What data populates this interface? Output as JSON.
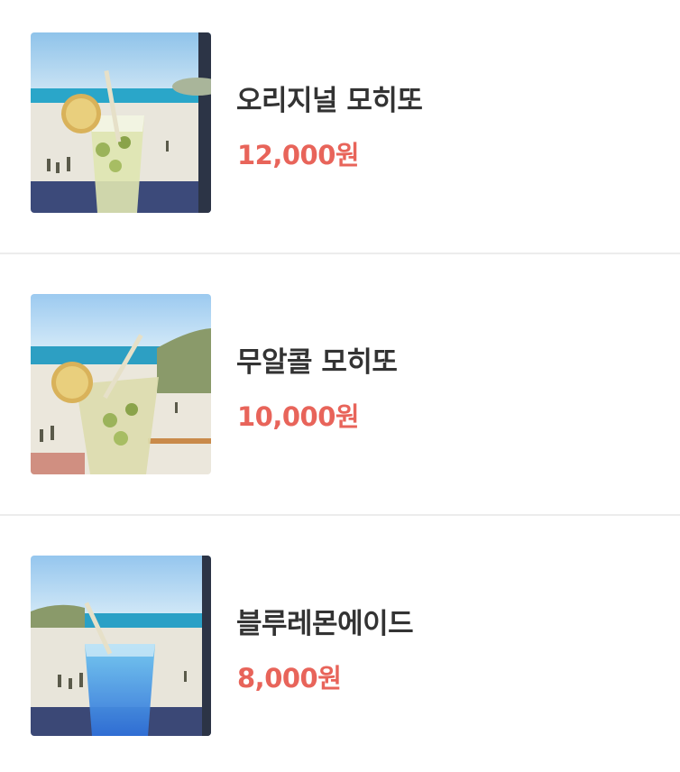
{
  "menu": {
    "items": [
      {
        "name": "오리지널 모히또",
        "price": "12,000원",
        "image": "mojito-beach-photo"
      },
      {
        "name": "무알콜 모히또",
        "price": "10,000원",
        "image": "mojito-beach-photo"
      },
      {
        "name": "블루레몬에이드",
        "price": "8,000원",
        "image": "blue-lemonade-beach-photo"
      }
    ]
  },
  "colors": {
    "price": "#e8645a",
    "name": "#333333",
    "divider": "#ececec"
  }
}
